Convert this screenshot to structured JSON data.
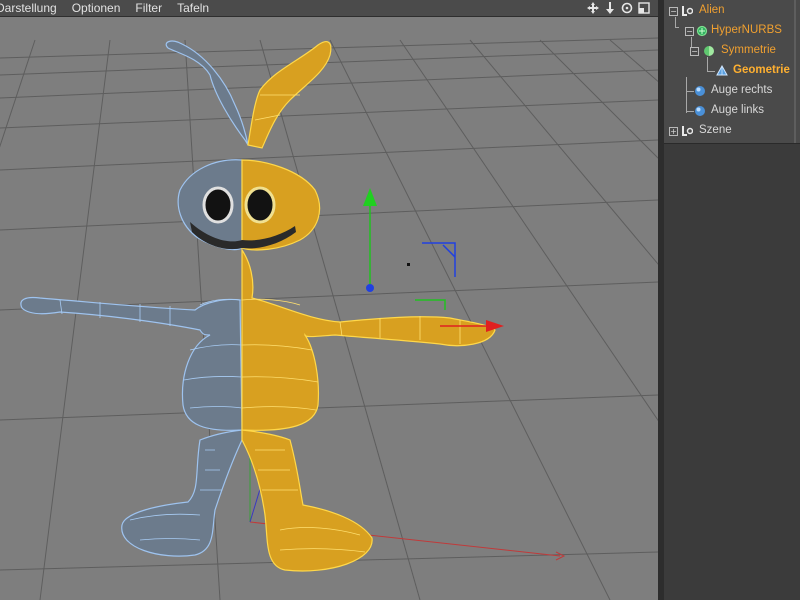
{
  "menu": {
    "items": [
      "Darstellung",
      "Optionen",
      "Filter",
      "Tafeln"
    ]
  },
  "nav_icons": [
    "move-view-icon",
    "dolly-view-icon",
    "rotate-view-icon",
    "toggle-view-icon"
  ],
  "objects": {
    "items": [
      {
        "label": "Alien",
        "icon": "null-object-icon",
        "color": "#f0a030",
        "expanded": true
      },
      {
        "label": "HyperNURBS",
        "icon": "hypernurbs-icon",
        "color": "#f0a030",
        "expanded": true
      },
      {
        "label": "Symmetrie",
        "icon": "symmetry-icon",
        "color": "#f0a030",
        "expanded": true
      },
      {
        "label": "Geometrie",
        "icon": "polygon-object-icon",
        "color": "#ffb030",
        "selected": true
      },
      {
        "label": "Auge rechts",
        "icon": "sphere-icon",
        "color": "#d8d8d8"
      },
      {
        "label": "Auge links",
        "icon": "sphere-icon",
        "color": "#d8d8d8"
      },
      {
        "label": "Szene",
        "icon": "null-object-icon",
        "color": "#d8d8d8",
        "expanded": false
      }
    ]
  },
  "colors": {
    "viewport_bg": "#7e7e7e",
    "mesh_blue": "#8fb8e6",
    "mesh_orange": "#ffc61a",
    "axis_x": "#e02020",
    "axis_y": "#20c020",
    "axis_z": "#2040e0",
    "selected_text": "#ffb030"
  }
}
